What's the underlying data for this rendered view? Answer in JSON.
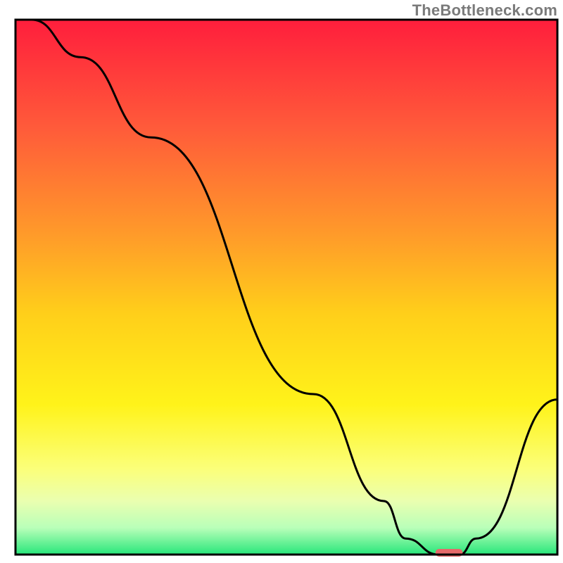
{
  "watermark": "TheBottleneck.com",
  "chart_data": {
    "type": "line",
    "title": "",
    "xlabel": "",
    "ylabel": "",
    "xlim": [
      0,
      100
    ],
    "ylim": [
      0,
      100
    ],
    "x": [
      0,
      3,
      12,
      25,
      55,
      68,
      72,
      78,
      82,
      85,
      100
    ],
    "values": [
      103,
      100,
      93,
      78,
      30,
      10,
      3,
      0,
      0,
      3,
      29
    ],
    "marker": {
      "x_center": 80,
      "y": 0,
      "half_width": 2.5
    },
    "background_gradient_stops": [
      {
        "offset": 0.0,
        "color": "#ff1e3c"
      },
      {
        "offset": 0.2,
        "color": "#ff5a3a"
      },
      {
        "offset": 0.4,
        "color": "#ff9a2a"
      },
      {
        "offset": 0.55,
        "color": "#ffcf1a"
      },
      {
        "offset": 0.72,
        "color": "#fff31a"
      },
      {
        "offset": 0.84,
        "color": "#fbff7a"
      },
      {
        "offset": 0.9,
        "color": "#eaffb0"
      },
      {
        "offset": 0.95,
        "color": "#b9ffb9"
      },
      {
        "offset": 1.0,
        "color": "#27e67a"
      }
    ],
    "curve_color": "#000000",
    "frame_color": "#000000",
    "marker_color": "#e66a6a"
  }
}
